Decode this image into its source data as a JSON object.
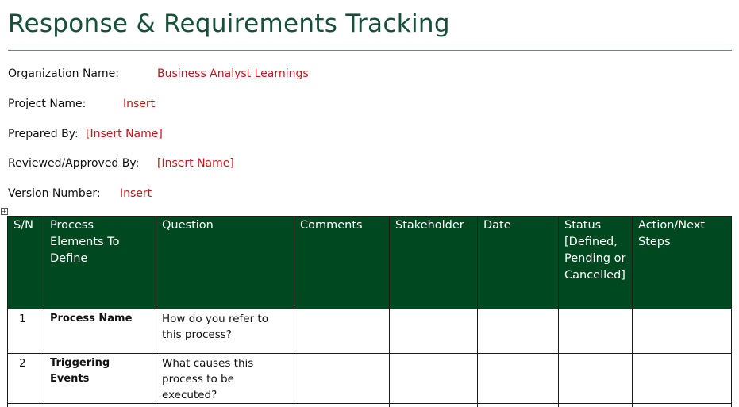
{
  "document": {
    "title": "Response & Requirements Tracking"
  },
  "fields": [
    {
      "label": "Organization Name:",
      "value": "Business Analyst Learnings"
    },
    {
      "label": "Project Name:",
      "value": "Insert"
    },
    {
      "label": "Prepared By:",
      "value": "[Insert Name]"
    },
    {
      "label": "Reviewed/Approved By:",
      "value": "[Insert Name]"
    },
    {
      "label": "Version Number:",
      "value": "Insert"
    }
  ],
  "table": {
    "headers": [
      "S/N",
      "Process Elements To Define",
      "Question",
      "Comments",
      "Stakeholder",
      "Date",
      "Status [Defined, Pending or Cancelled]",
      "Action/Next Steps"
    ],
    "rows": [
      {
        "sn": "1",
        "element": "Process Name",
        "question": "How do you refer to this process?",
        "comments": "",
        "stakeholder": "",
        "date": "",
        "status": "",
        "action": ""
      },
      {
        "sn": "2",
        "element": "Triggering Events",
        "question": "What causes this process to be executed?",
        "comments": "",
        "stakeholder": "",
        "date": "",
        "status": "",
        "action": ""
      }
    ]
  },
  "colors": {
    "title": "#17503a",
    "header_bg": "#00481f",
    "value_text": "#c0161c"
  },
  "icons": {
    "table_handle": "move-handle-icon"
  }
}
